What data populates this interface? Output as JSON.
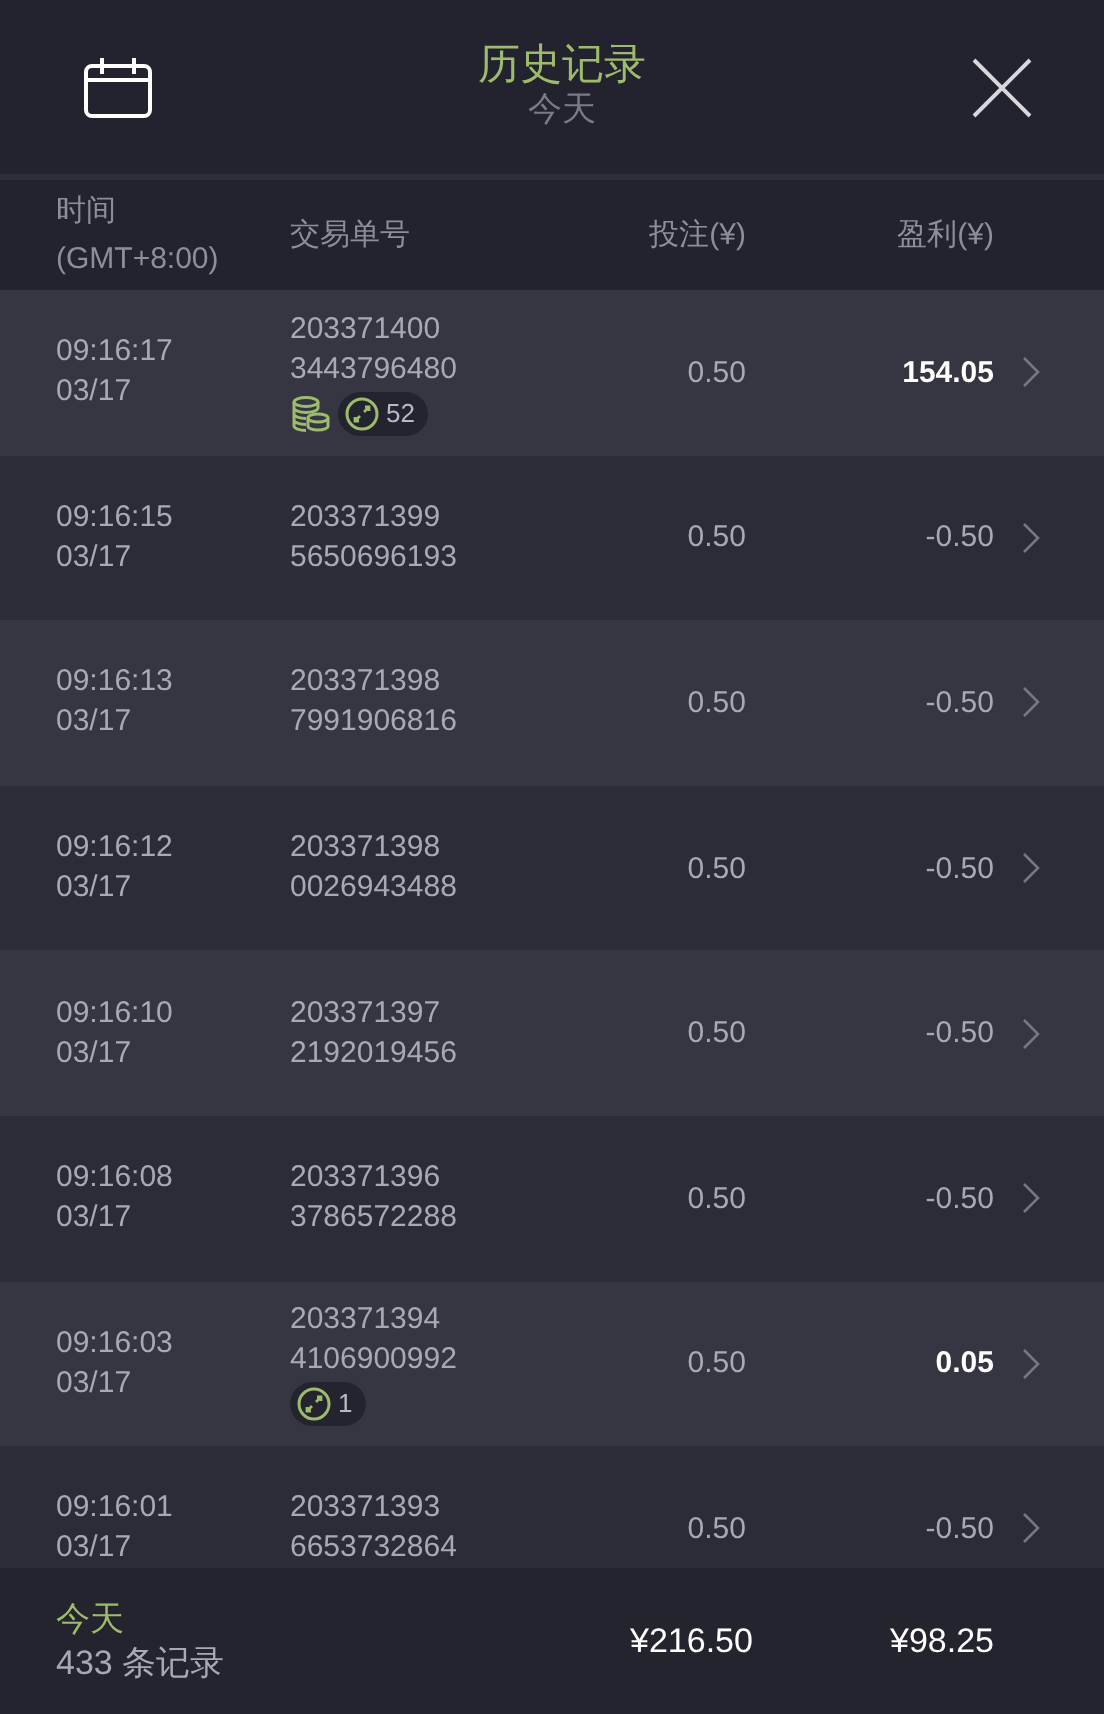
{
  "header": {
    "title": "历史记录",
    "subtitle": "今天"
  },
  "columns": {
    "time": "时间",
    "timezone": "(GMT+8:00)",
    "order": "交易单号",
    "stake": "投注(¥)",
    "profit": "盈利(¥)"
  },
  "rows": [
    {
      "time": "09:16:17",
      "date": "03/17",
      "order_1": "203371400",
      "order_2": "3443796480",
      "stake": "0.50",
      "profit": "154.05",
      "won": true,
      "coins": true,
      "badge_count": "52"
    },
    {
      "time": "09:16:15",
      "date": "03/17",
      "order_1": "203371399",
      "order_2": "5650696193",
      "stake": "0.50",
      "profit": "-0.50",
      "won": false,
      "coins": false
    },
    {
      "time": "09:16:13",
      "date": "03/17",
      "order_1": "203371398",
      "order_2": "7991906816",
      "stake": "0.50",
      "profit": "-0.50",
      "won": false,
      "coins": false
    },
    {
      "time": "09:16:12",
      "date": "03/17",
      "order_1": "203371398",
      "order_2": "0026943488",
      "stake": "0.50",
      "profit": "-0.50",
      "won": false,
      "coins": false
    },
    {
      "time": "09:16:10",
      "date": "03/17",
      "order_1": "203371397",
      "order_2": "2192019456",
      "stake": "0.50",
      "profit": "-0.50",
      "won": false,
      "coins": false
    },
    {
      "time": "09:16:08",
      "date": "03/17",
      "order_1": "203371396",
      "order_2": "3786572288",
      "stake": "0.50",
      "profit": "-0.50",
      "won": false,
      "coins": false
    },
    {
      "time": "09:16:03",
      "date": "03/17",
      "order_1": "203371394",
      "order_2": "4106900992",
      "stake": "0.50",
      "profit": "0.05",
      "won": true,
      "coins": false,
      "badge_count": "1"
    },
    {
      "time": "09:16:01",
      "date": "03/17",
      "order_1": "203371393",
      "order_2": "6653732864",
      "stake": "0.50",
      "profit": "-0.50",
      "won": false,
      "coins": false
    }
  ],
  "footer": {
    "period": "今天",
    "count": "433 条记录",
    "total_stake": "¥216.50",
    "total_profit": "¥98.25"
  }
}
